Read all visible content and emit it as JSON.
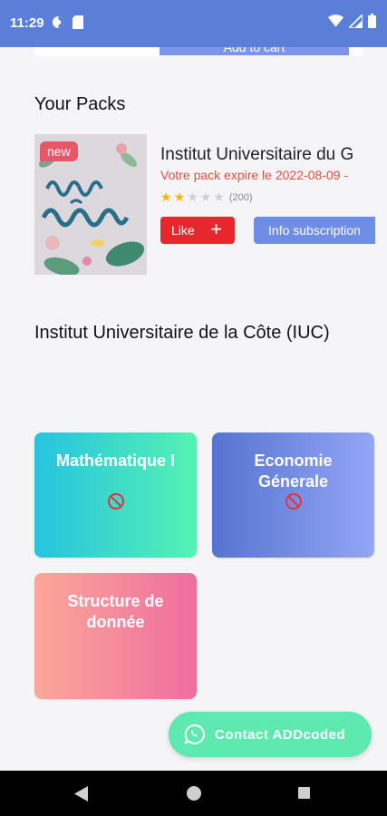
{
  "status_bar": {
    "time": "11:29",
    "color": "#5b7fd9"
  },
  "top_card": {
    "add_to_cart_label": "Add to cart"
  },
  "packs": {
    "section_title": "Your Packs",
    "item": {
      "badge": "new",
      "title": "Institut Universitaire du G",
      "expiry": "Votre pack expire le 2022-08-09 -",
      "rating": 2,
      "rating_max": 5,
      "rating_count": "(200)",
      "like_label": "Like",
      "info_label": "Info subscription"
    }
  },
  "institution": {
    "title": "Institut Universitaire de la Côte (IUC)",
    "courses": [
      {
        "label": "Mathématique I",
        "locked": true
      },
      {
        "label": "Economie Génerale",
        "locked": true
      },
      {
        "label": "Structure de donnée",
        "locked": false
      }
    ]
  },
  "contact": {
    "label": "Contact ADDcoded"
  },
  "colors": {
    "like": "#e8272d",
    "info": "#6d8de6",
    "expiry": "#e84b3c",
    "fab": "#5ee9b0"
  },
  "icons": [
    "play-protect-icon",
    "sim-card-icon",
    "wifi-icon",
    "signal-icon",
    "battery-icon",
    "no-entry-icon",
    "plus-icon",
    "whatsapp-icon",
    "back-icon",
    "home-icon",
    "recents-icon"
  ]
}
